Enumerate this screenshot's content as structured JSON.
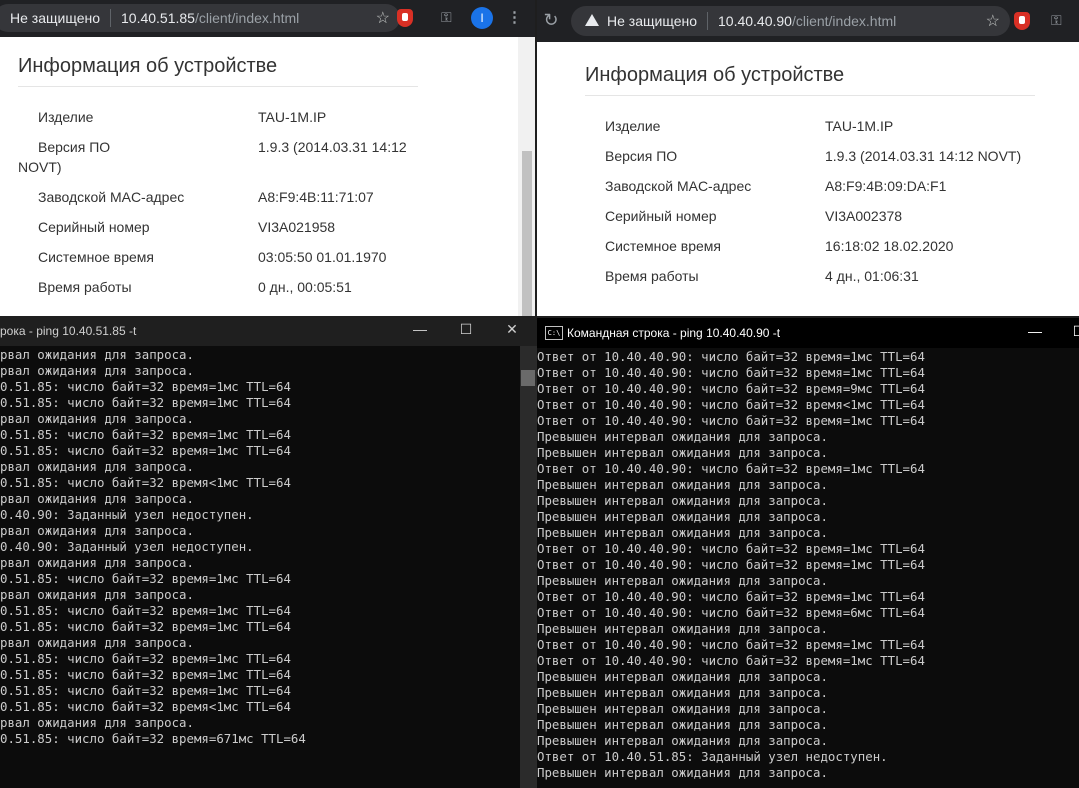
{
  "left_browser": {
    "security": "Не защищено",
    "host": "10.40.51.85",
    "path": "/client/index.html",
    "avatar_letter": "I",
    "page_title": "Информация об устройстве",
    "rows": [
      {
        "label": "Изделие",
        "value": "TAU-1M.IP"
      },
      {
        "label": "Версия ПО",
        "value": "1.9.3 (2014.03.31 14:12"
      },
      {
        "label": "Заводской MAC-адрес",
        "value": "A8:F9:4B:11:71:07"
      },
      {
        "label": "Серийный номер",
        "value": "VI3A021958"
      },
      {
        "label": "Системное время",
        "value": "03:05:50 01.01.1970"
      },
      {
        "label": "Время работы",
        "value": "0 дн., 00:05:51"
      }
    ],
    "version_wrap": "NOVT)"
  },
  "right_browser": {
    "security": "Не защищено",
    "host": "10.40.40.90",
    "path": "/client/index.html",
    "page_title": "Информация об устройстве",
    "rows": [
      {
        "label": "Изделие",
        "value": "TAU-1M.IP"
      },
      {
        "label": "Версия ПО",
        "value": "1.9.3 (2014.03.31 14:12 NOVT)"
      },
      {
        "label": "Заводской MAC-адрес",
        "value": "A8:F9:4B:09:DA:F1"
      },
      {
        "label": "Серийный номер",
        "value": "VI3A002378"
      },
      {
        "label": "Системное время",
        "value": "16:18:02 18.02.2020"
      },
      {
        "label": "Время работы",
        "value": "4 дн., 01:06:31"
      }
    ]
  },
  "left_console": {
    "title": "рока - ping  10.40.51.85 -t",
    "lines": [
      "рвал ожидания для запроса.",
      "рвал ожидания для запроса.",
      "0.51.85: число байт=32 время=1мс TTL=64",
      "0.51.85: число байт=32 время=1мс TTL=64",
      "рвал ожидания для запроса.",
      "0.51.85: число байт=32 время=1мс TTL=64",
      "0.51.85: число байт=32 время=1мс TTL=64",
      "рвал ожидания для запроса.",
      "0.51.85: число байт=32 время<1мс TTL=64",
      "рвал ожидания для запроса.",
      "0.40.90: Заданный узел недоступен.",
      "рвал ожидания для запроса.",
      "0.40.90: Заданный узел недоступен.",
      "рвал ожидания для запроса.",
      "0.51.85: число байт=32 время=1мс TTL=64",
      "рвал ожидания для запроса.",
      "0.51.85: число байт=32 время=1мс TTL=64",
      "0.51.85: число байт=32 время=1мс TTL=64",
      "рвал ожидания для запроса.",
      "0.51.85: число байт=32 время=1мс TTL=64",
      "0.51.85: число байт=32 время=1мс TTL=64",
      "0.51.85: число байт=32 время=1мс TTL=64",
      "0.51.85: число байт=32 время<1мс TTL=64",
      "рвал ожидания для запроса.",
      "0.51.85: число байт=32 время=671мс TTL=64"
    ]
  },
  "right_console": {
    "title": "Командная строка - ping  10.40.40.90 -t",
    "lines": [
      "Ответ от 10.40.40.90: число байт=32 время=1мс TTL=64",
      "Ответ от 10.40.40.90: число байт=32 время=1мс TTL=64",
      "Ответ от 10.40.40.90: число байт=32 время=9мс TTL=64",
      "Ответ от 10.40.40.90: число байт=32 время<1мс TTL=64",
      "Ответ от 10.40.40.90: число байт=32 время=1мс TTL=64",
      "Превышен интервал ожидания для запроса.",
      "Превышен интервал ожидания для запроса.",
      "Ответ от 10.40.40.90: число байт=32 время=1мс TTL=64",
      "Превышен интервал ожидания для запроса.",
      "Превышен интервал ожидания для запроса.",
      "Превышен интервал ожидания для запроса.",
      "Превышен интервал ожидания для запроса.",
      "Ответ от 10.40.40.90: число байт=32 время=1мс TTL=64",
      "Ответ от 10.40.40.90: число байт=32 время=1мс TTL=64",
      "Превышен интервал ожидания для запроса.",
      "Ответ от 10.40.40.90: число байт=32 время=1мс TTL=64",
      "Ответ от 10.40.40.90: число байт=32 время=6мс TTL=64",
      "Превышен интервал ожидания для запроса.",
      "Ответ от 10.40.40.90: число байт=32 время=1мс TTL=64",
      "Ответ от 10.40.40.90: число байт=32 время=1мс TTL=64",
      "Превышен интервал ожидания для запроса.",
      "Превышен интервал ожидания для запроса.",
      "Превышен интервал ожидания для запроса.",
      "Превышен интервал ожидания для запроса.",
      "Превышен интервал ожидания для запроса.",
      "Ответ от 10.40.51.85: Заданный узел недоступен.",
      "Превышен интервал ожидания для запроса."
    ]
  }
}
